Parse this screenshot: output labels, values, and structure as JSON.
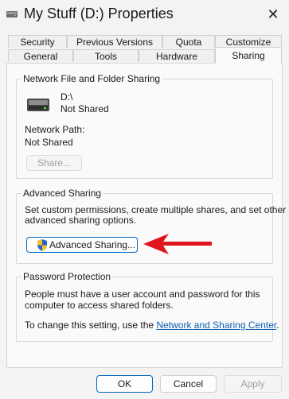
{
  "window": {
    "title": "My Stuff (D:) Properties",
    "close_glyph": "✕"
  },
  "tabs_row_back": [
    "Security",
    "Previous Versions",
    "Quota",
    "Customize"
  ],
  "tabs_row_front": [
    "General",
    "Tools",
    "Hardware",
    "Sharing"
  ],
  "active_tab": "Sharing",
  "network_sharing": {
    "title": "Network File and Folder Sharing",
    "drive_path": "D:\\",
    "drive_status": "Not Shared",
    "network_path_label": "Network Path:",
    "network_path_value": "Not Shared",
    "share_button": "Share..."
  },
  "advanced_sharing": {
    "title": "Advanced Sharing",
    "description_line1": "Set custom permissions, create multiple shares, and set other",
    "description_line2": "advanced sharing options.",
    "button": "Advanced Sharing..."
  },
  "password_protection": {
    "title": "Password Protection",
    "line1": "People must have a user account and password for this",
    "line2": "computer to access shared folders.",
    "line3_prefix": "To change this setting, use the",
    "link": "Network and Sharing Center",
    "line3_suffix": "."
  },
  "footer": {
    "ok": "OK",
    "cancel": "Cancel",
    "apply": "Apply"
  },
  "colors": {
    "accent": "#0067c0",
    "annotation_arrow": "#e0141e"
  }
}
